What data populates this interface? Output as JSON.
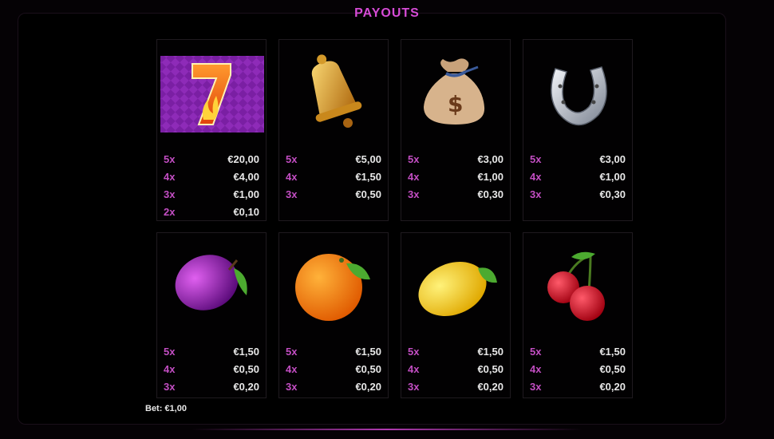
{
  "title": "PAYOUTS",
  "bet_label": "Bet: €1,00",
  "colors": {
    "title": "#d64bd6",
    "multiplier": "#c34ec3",
    "amount": "#e8e8e8"
  },
  "symbols": [
    {
      "icon": "seven-icon",
      "payouts": [
        {
          "mult": "5x",
          "amount": "€20,00"
        },
        {
          "mult": "4x",
          "amount": "€4,00"
        },
        {
          "mult": "3x",
          "amount": "€1,00"
        },
        {
          "mult": "2x",
          "amount": "€0,10"
        }
      ]
    },
    {
      "icon": "bell-icon",
      "payouts": [
        {
          "mult": "5x",
          "amount": "€5,00"
        },
        {
          "mult": "4x",
          "amount": "€1,50"
        },
        {
          "mult": "3x",
          "amount": "€0,50"
        }
      ]
    },
    {
      "icon": "money-bag-icon",
      "payouts": [
        {
          "mult": "5x",
          "amount": "€3,00"
        },
        {
          "mult": "4x",
          "amount": "€1,00"
        },
        {
          "mult": "3x",
          "amount": "€0,30"
        }
      ]
    },
    {
      "icon": "horseshoe-icon",
      "payouts": [
        {
          "mult": "5x",
          "amount": "€3,00"
        },
        {
          "mult": "4x",
          "amount": "€1,00"
        },
        {
          "mult": "3x",
          "amount": "€0,30"
        }
      ]
    },
    {
      "icon": "plum-icon",
      "payouts": [
        {
          "mult": "5x",
          "amount": "€1,50"
        },
        {
          "mult": "4x",
          "amount": "€0,50"
        },
        {
          "mult": "3x",
          "amount": "€0,20"
        }
      ]
    },
    {
      "icon": "orange-icon",
      "payouts": [
        {
          "mult": "5x",
          "amount": "€1,50"
        },
        {
          "mult": "4x",
          "amount": "€0,50"
        },
        {
          "mult": "3x",
          "amount": "€0,20"
        }
      ]
    },
    {
      "icon": "lemon-icon",
      "payouts": [
        {
          "mult": "5x",
          "amount": "€1,50"
        },
        {
          "mult": "4x",
          "amount": "€0,50"
        },
        {
          "mult": "3x",
          "amount": "€0,20"
        }
      ]
    },
    {
      "icon": "cherries-icon",
      "payouts": [
        {
          "mult": "5x",
          "amount": "€1,50"
        },
        {
          "mult": "4x",
          "amount": "€0,50"
        },
        {
          "mult": "3x",
          "amount": "€0,20"
        }
      ]
    }
  ]
}
